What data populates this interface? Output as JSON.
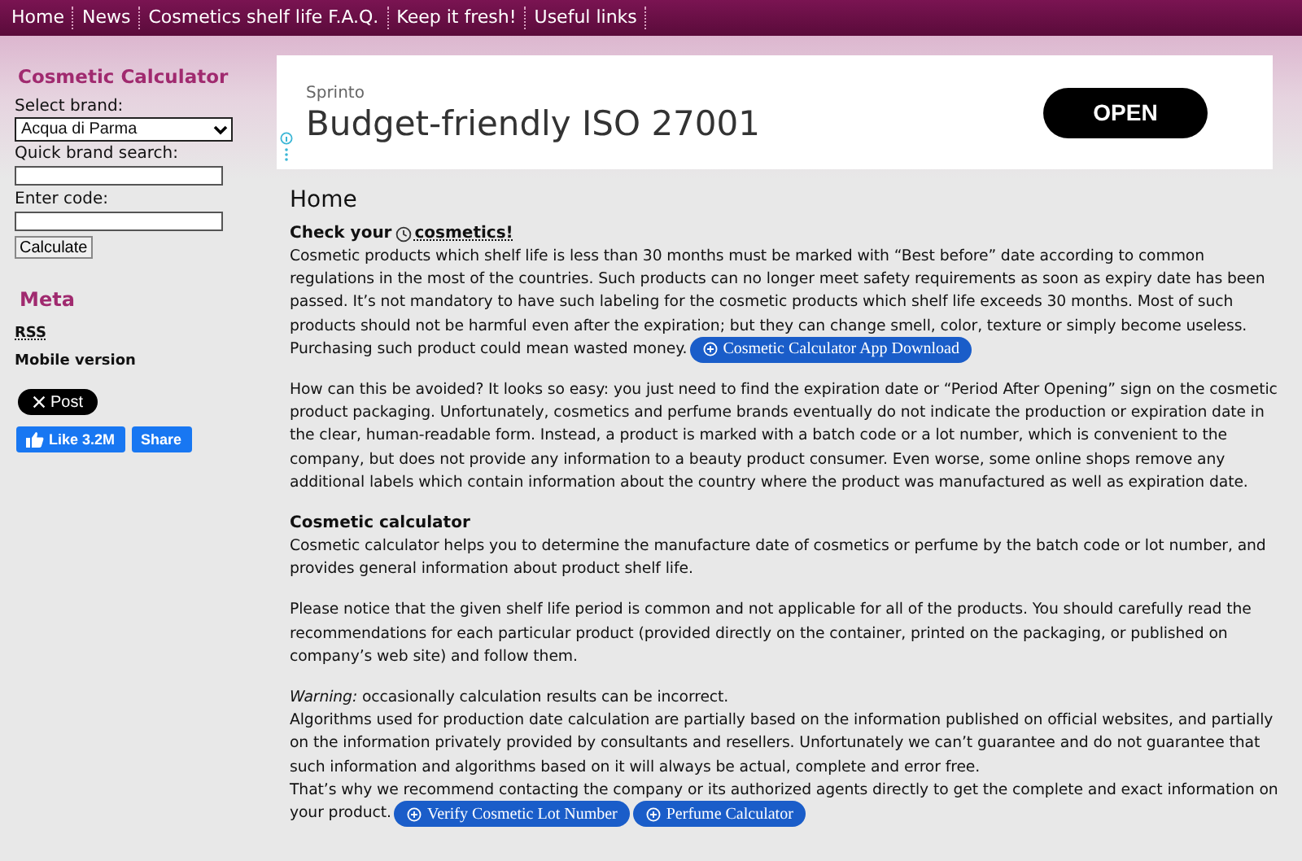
{
  "nav": [
    {
      "label": "Home"
    },
    {
      "label": "News"
    },
    {
      "label": "Cosmetics shelf life F.A.Q."
    },
    {
      "label": "Keep it fresh!"
    },
    {
      "label": "Useful links"
    }
  ],
  "sidebar": {
    "calculator": {
      "title": "Cosmetic Calculator",
      "brand_label": "Select brand:",
      "brand_value": "Acqua di Parma",
      "search_label": "Quick brand search:",
      "code_label": "Enter code:",
      "button": "Calculate"
    },
    "meta": {
      "title": "Meta",
      "links": [
        {
          "label": "RSS",
          "kind": "abbr"
        },
        {
          "label": "Mobile version",
          "kind": "link"
        }
      ]
    },
    "x_button": "Post",
    "fb_like": "Like 3.2M",
    "fb_share": "Share"
  },
  "ad": {
    "brand": "Sprinto",
    "headline": "Budget-friendly ISO 27001",
    "button": "OPEN"
  },
  "content": {
    "title": "Home",
    "sections": [
      {
        "heading_before": "Check your",
        "heading_link": "cosmetics!",
        "paragraphs": [
          {
            "lines": [
              "Cosmetic products which shelf life is less than 30 months must be marked with “Best before” date according to common regulations in the most of the countries. Such products can no longer meet safety requirements as soon as expiry date has been passed. It’s not mandatory to have such labeling for the cosmetic products which shelf life exceeds 30 months. Most of such products should not be harmful even after the expiration; but they can change smell, color, texture or simply become useless."
            ],
            "tail": "Purchasing such product could mean wasted money.",
            "buttons": [
              "Cosmetic Calculator App Download"
            ]
          },
          {
            "lines": [
              "How can this be avoided? It looks so easy: you just need to find the expiration date or “Period After Opening” sign on the cosmetic product packaging. Unfortunately, cosmetics and perfume brands eventually do not indicate the production or expiration date in the clear, human-readable form. Instead, a product is marked with a batch code or a lot number, which is convenient to the company, but does not provide any information to a beauty product consumer. Even worse, some online shops remove any additional labels which contain information about the country where the product was manufactured as well as expiration date."
            ]
          }
        ]
      },
      {
        "heading": "Cosmetic calculator",
        "paragraphs": [
          {
            "lines": [
              "Cosmetic calculator helps you to determine the manufacture date of cosmetics or perfume by the batch code or lot number, and provides general information about product shelf life."
            ]
          },
          {
            "lines": [
              "Please notice that the given shelf life period is common and not applicable for all of the products. You should carefully read the recommendations for each particular product (provided directly on the container, printed on the packaging, or published on company’s web site) and follow them."
            ]
          },
          {
            "lines": [
              "*Warning:* occasionally calculation results can be incorrect.",
              "Algorithms used for production date calculation are partially based on the information published on official websites, and partially on the information privately provided by consultants and resellers. Unfortunately we can’t guarantee and do not guarantee that such information and algorithms based on it will always be actual, complete and error free.",
              "That’s why we recommend contacting the company or its authorized agents directly to get the complete and exact information on"
            ],
            "tail": "your product.",
            "buttons": [
              "Verify Cosmetic Lot Number",
              "Perfume Calculator"
            ]
          }
        ]
      }
    ]
  }
}
